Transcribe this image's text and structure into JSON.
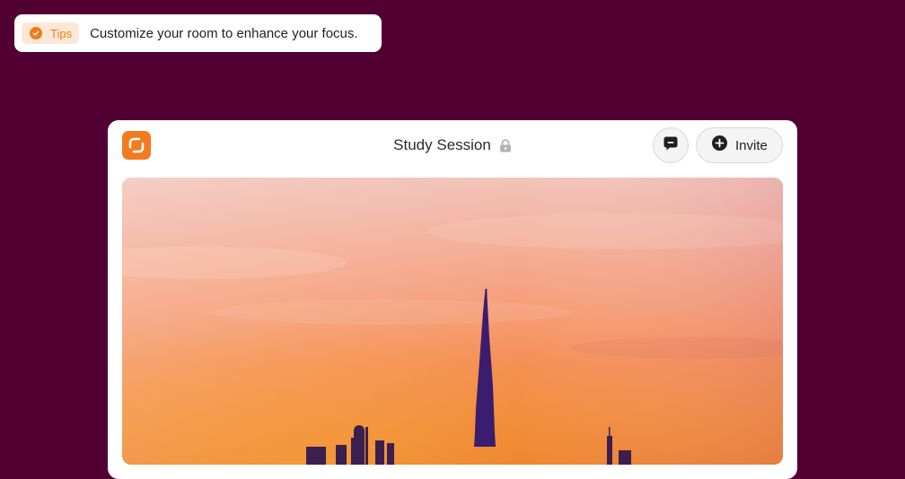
{
  "tip": {
    "badge_label": "Tips",
    "badge_icon": "check-circle-icon",
    "message": "Customize your room to enhance your focus."
  },
  "room": {
    "logo_icon": "app-logo-icon",
    "title": "Study Session",
    "title_icon": "lock-icon",
    "chat_button_icon": "chat-bubble-icon",
    "invite_label": "Invite",
    "invite_icon": "plus-circle-icon",
    "scene": "sunset-city-skyline"
  },
  "colors": {
    "background": "#520033",
    "accent": "#f47a1f",
    "tip_badge_bg": "#fde8d8"
  }
}
